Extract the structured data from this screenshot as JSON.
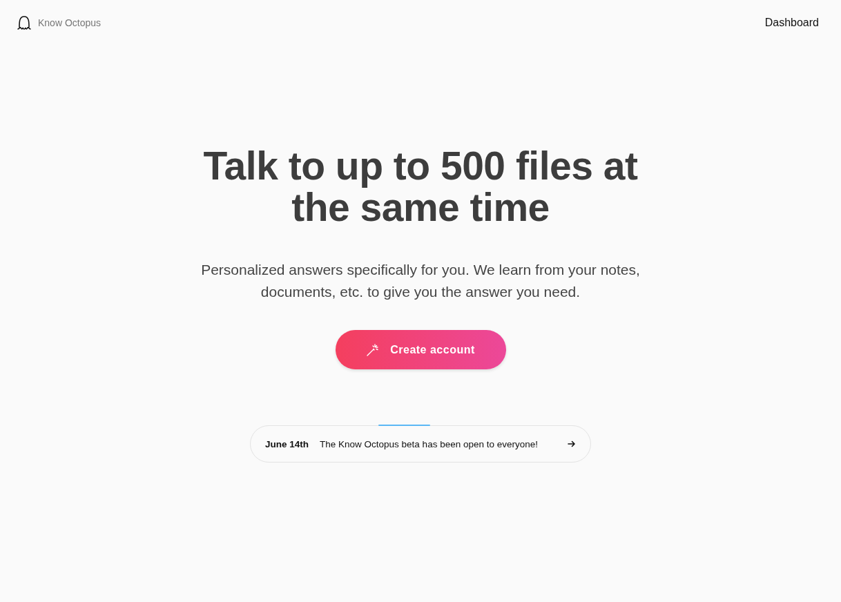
{
  "header": {
    "brand": "Know Octopus",
    "nav_link": "Dashboard"
  },
  "hero": {
    "title": "Talk to up to 500 files at the same time",
    "subtitle": "Personalized answers specifically for you. We learn from your notes, documents, etc. to give you the answer you need.",
    "cta": "Create account"
  },
  "announcement": {
    "date": "June 14th",
    "text": "The Know Octopus beta has been open to everyone!"
  }
}
